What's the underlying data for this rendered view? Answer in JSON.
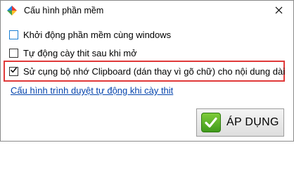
{
  "window": {
    "title": "Cấu hình phần mềm"
  },
  "options": [
    {
      "label": "Khởi động phần mềm cùng windows",
      "checked": false
    },
    {
      "label": "Tự động cày thit sau khi mở",
      "checked": false
    },
    {
      "label": "Sử cụng bộ nhớ Clipboard (dán thay vì gõ chữ) cho nội dung dài",
      "checked": true
    }
  ],
  "link": {
    "label": "Cấu hình trình duyệt tự động khi cày thit"
  },
  "apply_button": {
    "label": "ÁP DỤNG"
  },
  "colors": {
    "highlight": "#e03a3a",
    "link": "#0645ad",
    "apply_icon": "#4caf24"
  },
  "icons": {
    "app": "app-logo-icon",
    "close": "close-icon",
    "apply": "checkmark-icon"
  }
}
